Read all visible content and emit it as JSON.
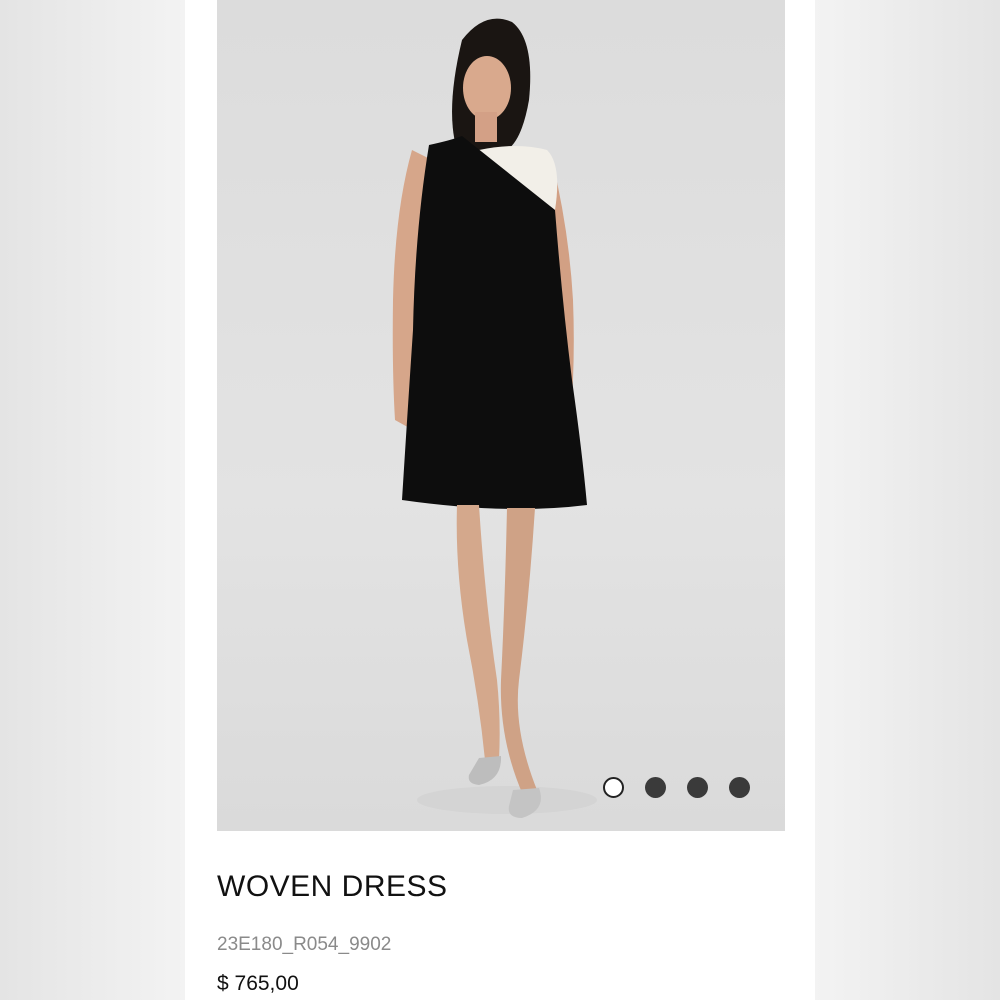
{
  "product": {
    "image": {
      "alt": "",
      "gallery_count": 4,
      "active_index": 0
    },
    "title": "WOVEN DRESS",
    "sku": "23E180_R054_9902",
    "price": "$ 765,00"
  },
  "colors": {
    "page_background": "#e9e9e9",
    "card_background": "#ffffff",
    "dress_black": "#0d0d0d",
    "dress_white": "#f2efe8",
    "dot_inactive": "#3a3a3a",
    "dot_active": "#ffffff"
  }
}
